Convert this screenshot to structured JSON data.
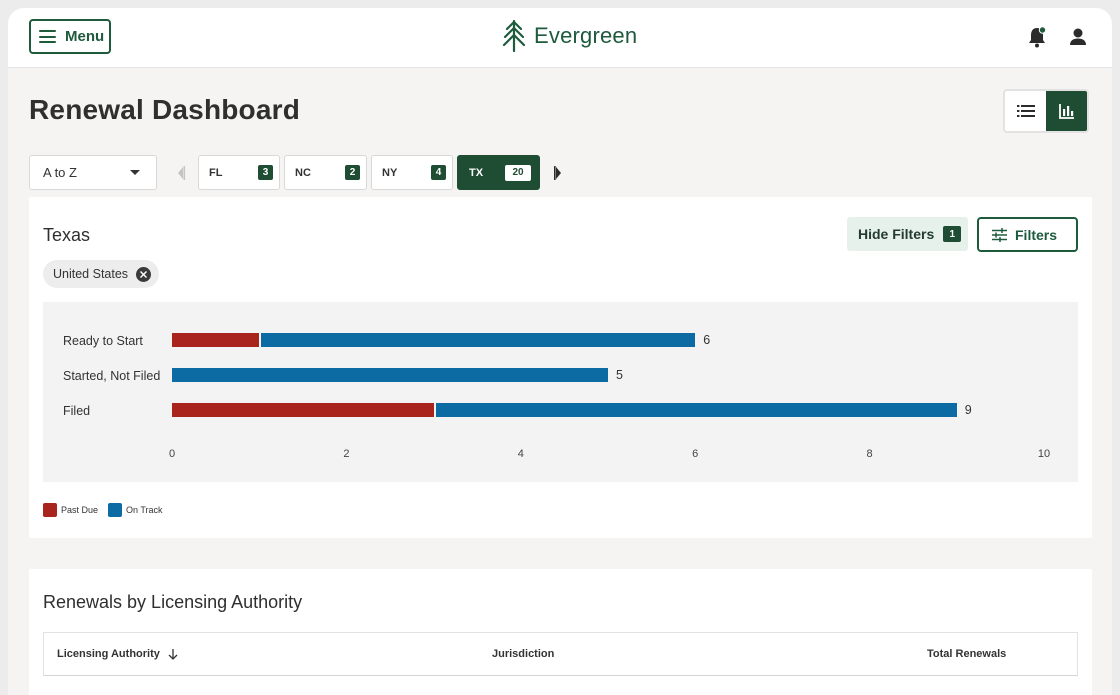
{
  "header": {
    "menu_label": "Menu",
    "brand_name": "Evergreen"
  },
  "page": {
    "title": "Renewal Dashboard"
  },
  "sort": {
    "selected": "A to Z"
  },
  "state_tabs": [
    {
      "label": "FL",
      "count": "3",
      "active": false
    },
    {
      "label": "NC",
      "count": "2",
      "active": false
    },
    {
      "label": "NY",
      "count": "4",
      "active": false
    },
    {
      "label": "TX",
      "count": "20",
      "active": true
    }
  ],
  "chart_card": {
    "title": "Texas",
    "hide_filters_label": "Hide Filters",
    "hide_filters_count": "1",
    "filters_label": "Filters",
    "chip_label": "United States"
  },
  "colors": {
    "brand_green": "#1e4d34",
    "past_due": "#a8241d",
    "on_track": "#0c6ba3"
  },
  "chart_data": {
    "type": "bar",
    "orientation": "horizontal",
    "stacked": true,
    "categories": [
      "Ready to Start",
      "Started, Not Filed",
      "Filed"
    ],
    "series": [
      {
        "name": "Past Due",
        "values": [
          1,
          0,
          3
        ]
      },
      {
        "name": "On Track",
        "values": [
          5,
          5,
          6
        ]
      }
    ],
    "totals": [
      "6",
      "5",
      "9"
    ],
    "xlim": [
      0,
      10
    ],
    "xticks": [
      "0",
      "2",
      "4",
      "6",
      "8",
      "10"
    ],
    "legend": "bottom-left",
    "grid": false
  },
  "table_card": {
    "title": "Renewals by Licensing Authority",
    "columns": [
      "Licensing Authority",
      "Jurisdiction",
      "Total Renewals"
    ]
  }
}
